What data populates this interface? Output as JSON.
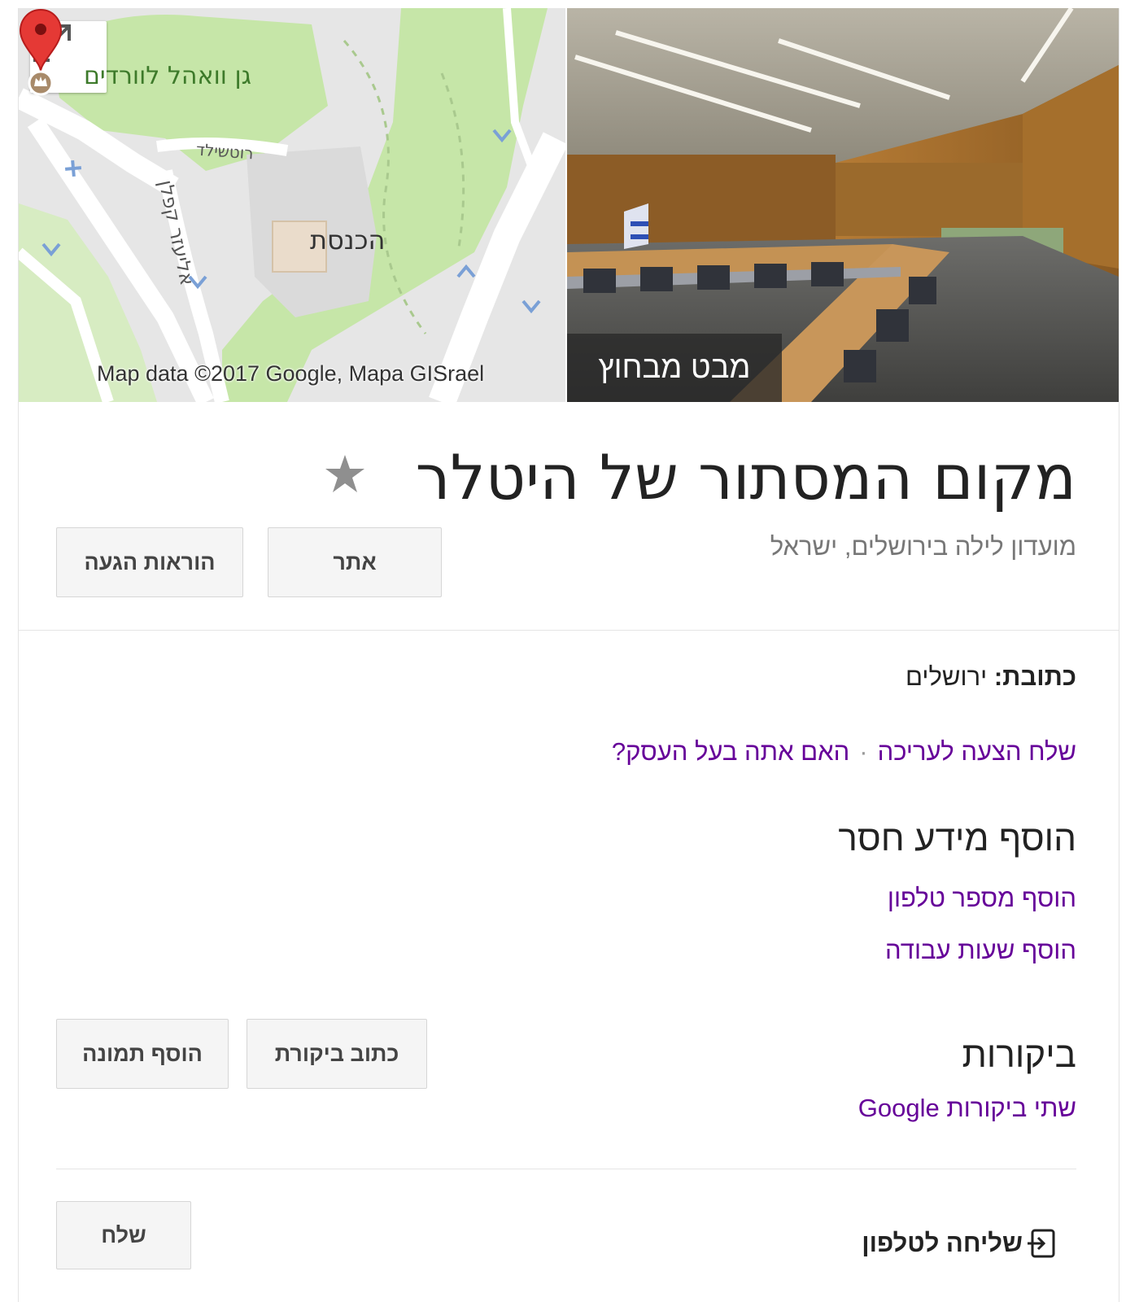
{
  "map": {
    "park_label": "גן וואהל לוורדים",
    "street_label": "רוטשילד",
    "street2_label": "אליעזר קפלן",
    "place_label": "הכנסת",
    "attribution": "Map data ©2017 Google, Mapa GISrael"
  },
  "photo": {
    "caption": "מבט מבחוץ"
  },
  "place": {
    "title": "מקום המסתור של היטלר",
    "subtitle": "מועדון לילה בירושלים, ישראל"
  },
  "actions": {
    "website": "אתר",
    "directions": "הוראות הגעה"
  },
  "details": {
    "address_key": "כתובת:",
    "address_value": "ירושלים",
    "suggest_edit": "שלח הצעה לעריכה",
    "separator": "·",
    "own_business": "האם אתה בעל העסק?"
  },
  "missing_info": {
    "heading": "הוסף מידע חסר",
    "add_phone": "הוסף מספר טלפון",
    "add_hours": "הוסף שעות עבודה"
  },
  "reviews": {
    "heading": "ביקורות",
    "summary": "שתי ביקורות Google",
    "write_review": "כתוב ביקורת",
    "add_photo": "הוסף תמונה"
  },
  "send_to_phone": {
    "label": "שליחה לטלפון",
    "button": "שלח"
  },
  "colors": {
    "link": "#660099",
    "map_park": "#c6e6a8",
    "map_road": "#ffffff",
    "pin": "#e53935"
  }
}
